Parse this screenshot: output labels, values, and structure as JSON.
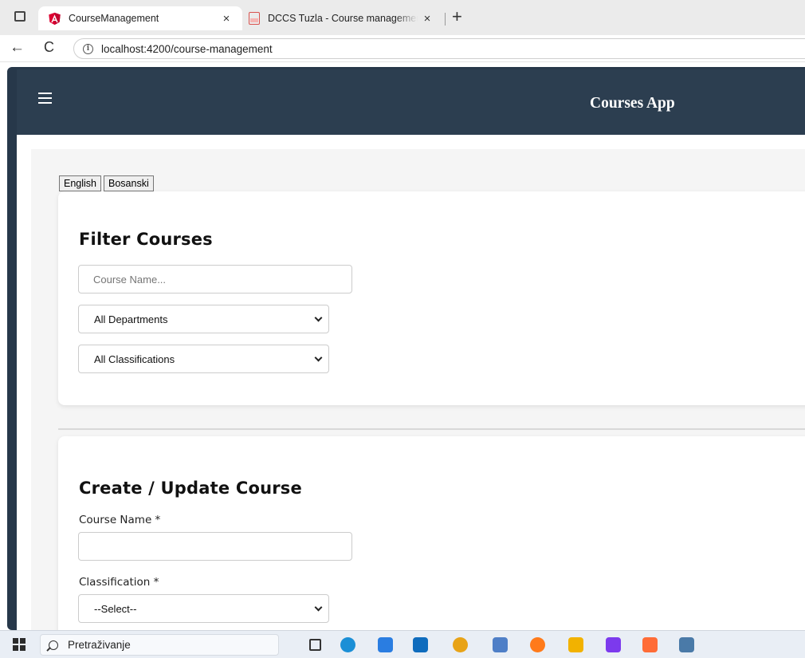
{
  "browser": {
    "tabs": [
      {
        "title": "CourseManagement",
        "close": "×",
        "active": true,
        "favicon": "angular-icon"
      },
      {
        "title": "DCCS Tuzla - Course managemen",
        "close": "×",
        "active": false,
        "favicon": "pdf-icon"
      }
    ],
    "new_tab": "+",
    "back": "←",
    "reload": "C",
    "info": "i",
    "url": "localhost:4200/course-management"
  },
  "app": {
    "title": "Courses App",
    "menu_icon": "hamburger-icon",
    "colors": {
      "navbar": "#2c3e50",
      "page": "#f5f5f5",
      "card": "#ffffff"
    }
  },
  "language": {
    "options": [
      "English",
      "Bosanski"
    ]
  },
  "filter": {
    "heading": "Filter Courses",
    "name_placeholder": "Course Name...",
    "department_selected": "All Departments",
    "classification_selected": "All Classifications"
  },
  "create": {
    "heading": "Create / Update Course",
    "name_label": "Course Name *",
    "name_value": "",
    "classification_label": "Classification *",
    "classification_selected": "--Select--"
  },
  "taskbar": {
    "search_text": "Pretraživanje",
    "apps": [
      {
        "name": "edge-icon",
        "color": "#1b8fd6"
      },
      {
        "name": "store-icon",
        "color": "#2a7de1"
      },
      {
        "name": "outlook-icon",
        "color": "#0f6cbd"
      },
      {
        "name": "chrome-icon",
        "color": "#e8a317"
      },
      {
        "name": "notepad-icon",
        "color": "#4f7fc7"
      },
      {
        "name": "firefox-icon",
        "color": "#ff7a1a"
      },
      {
        "name": "file-explorer-icon",
        "color": "#f2b200"
      },
      {
        "name": "jetbrains-icon",
        "color": "#7c3aed"
      },
      {
        "name": "postman-icon",
        "color": "#ff6c37"
      },
      {
        "name": "mysql-workbench-icon",
        "color": "#4a7aa8"
      }
    ]
  }
}
